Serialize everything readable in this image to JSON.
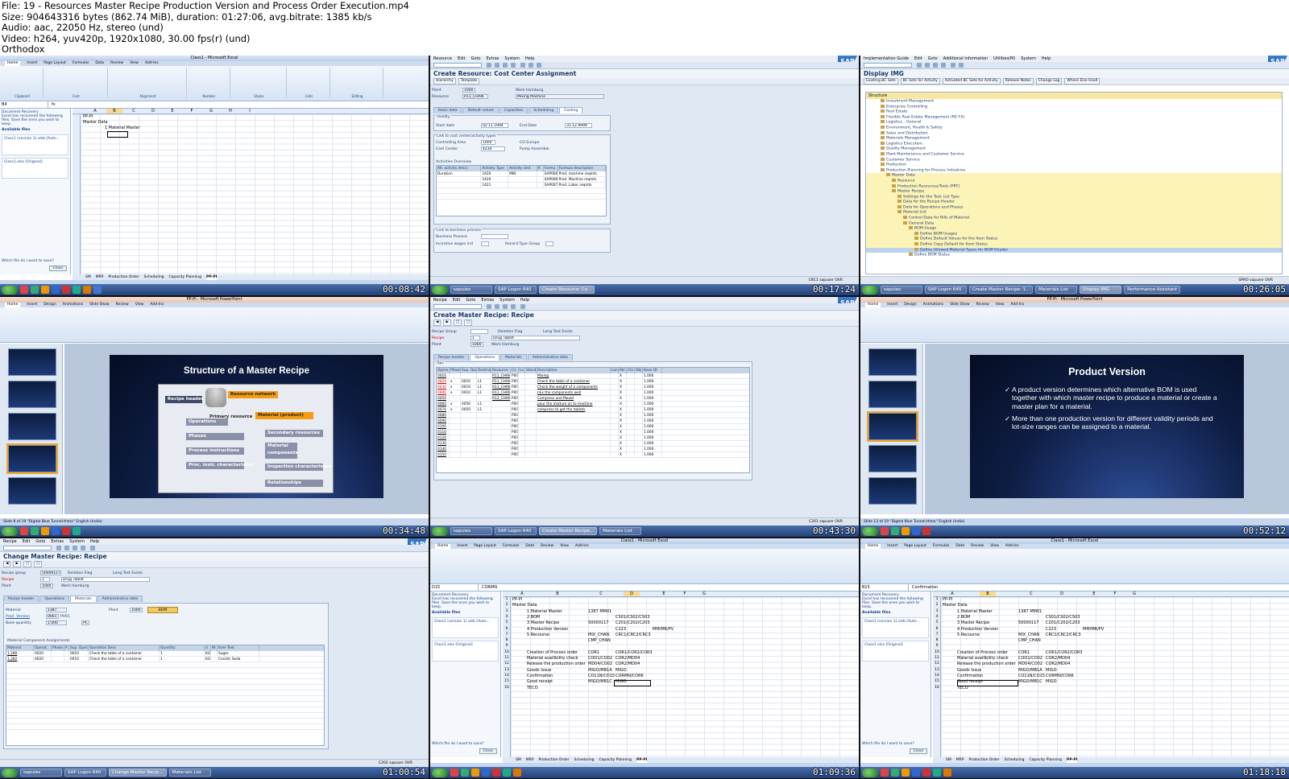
{
  "header": {
    "lines": [
      "File: 19 - Resources Master Recipe Production Version and Process Order Execution.mp4",
      "Size: 904643316 bytes (862.74 MiB), duration: 01:27:06, avg.bitrate: 1385 kb/s",
      "Audio: aac, 22050 Hz, stereo (und)",
      "Video: h264, yuv420p, 1920x1080, 30.00 fps(r) (und)",
      "Orthodox"
    ]
  },
  "tiles": {
    "t1": {
      "timestamp": "00:08:42",
      "title": "Class1 - Microsoft Excel",
      "name_box": "B4",
      "recovery_title": "Document Recovery",
      "recovery_text": "Excel has recovered the following files. Save the ones you wish to keep.",
      "available": "Available files",
      "file1": "Class1 (version 1).xlsb [Auto...",
      "file2": "Class1.xlsx [Original]",
      "close": "Close",
      "which": "Which file do I want to save?",
      "cells": {
        "a1": "PP-PI",
        "a2": "Master Data",
        "b4": "1 Material Master"
      },
      "sheets": [
        "SM",
        "MRP",
        "Production Order",
        "Scheduling",
        "Capacity Planning",
        "PP-PI"
      ]
    },
    "t2": {
      "timestamp": "00:17:24",
      "menu": [
        "Resource",
        "Edit",
        "Goto",
        "Extras",
        "System",
        "Help"
      ],
      "title": "Create Resource: Cost Center Assignment",
      "btn1": "Hierarchy",
      "btn2": "Template",
      "plant_lbl": "Plant",
      "plant": "1000",
      "plant_desc": "Werk Hamburg",
      "res_lbl": "Resource",
      "res": "R11_CHAN",
      "res_desc": "Mixing Machine",
      "tabs": [
        "Basic data",
        "Default values",
        "Capacities",
        "Scheduling",
        "Costing"
      ],
      "validity": "Validity",
      "start_lbl": "Start date",
      "start": "02.11.1994",
      "end_lbl": "End Date",
      "end": "31.12.9999",
      "link_cc": "Link to cost center/activity types",
      "ca_lbl": "Controlling Area",
      "ca": "1000",
      "ca_desc": "CO Europe",
      "cc_lbl": "Cost Center",
      "cc": "4230",
      "cc_desc": "Pump Assemble",
      "act_overview": "Activities Overview",
      "cols": [
        "Alt. activity descr.",
        "Activity Type",
        "Activity Unit",
        "R",
        "Formu",
        "Formula description"
      ],
      "rows": [
        [
          "Duration",
          "1420",
          "MIN",
          "",
          "SAP006",
          "Prod. machine reqmts"
        ],
        [
          "",
          "1420",
          "",
          "",
          "SAP006",
          "Prod. Machine reqmts"
        ],
        [
          "",
          "1421",
          "",
          "",
          "SAP007",
          "Prod. Labor reqmts"
        ]
      ],
      "link_bp": "Link to business process",
      "bp_lbl": "Business Process",
      "inc_lbl": "Incentive wages ind",
      "rec_lbl": "Record Type Group",
      "status": "CRC1 sapuser OVR"
    },
    "t3": {
      "timestamp": "00:26:05",
      "menu": [
        "Implementation Guide",
        "Edit",
        "Goto",
        "Additional information",
        "Utilities(M)",
        "System",
        "Help"
      ],
      "title": "Display IMG",
      "btns": [
        "Existing BC Sets",
        "BC Sets for Activity",
        "Activated BC Sets for Activity",
        "Release Notes",
        "Change Log",
        "Where Else Used"
      ],
      "structure": "Structure",
      "items": [
        "Investment Management",
        "Enterprise Controlling",
        "Real Estate",
        "Flexible Real Estate Management (RE-FX)",
        "Logistics - General",
        "Environment, Health & Safety",
        "Sales and Distribution",
        "Materials Management",
        "Logistics Execution",
        "Quality Management",
        "Plant Maintenance and Customer Service",
        "Customer Service",
        "Production",
        "Production Planning for Process Industries",
        "Master Data",
        "Resource",
        "Production Resources/Tools (PRT)",
        "Master Recipe",
        "Settings for the Task List Type",
        "Data for the Recipe Header",
        "Data for Operations and Phases",
        "Material List",
        "Control Data for Bills of Material",
        "General Data",
        "BOM Usage",
        "Define BOM Usages",
        "Define Default Values for the Item Status",
        "Define Copy Default for Item Status",
        "Define Allowed Material Types for BOM Header",
        "Define BOM Status"
      ],
      "status": "SPRO sapuser OVR"
    },
    "t4": {
      "timestamp": "00:34:48",
      "title": "PP-PI - Microsoft PowerPoint",
      "slide_title": "Structure of a Master Recipe",
      "boxes": [
        "Recipe header",
        "Resource network",
        "Material (product)",
        "Operations",
        "Primary resource",
        "Phases",
        "Secondary resources",
        "Process instructions",
        "Material components",
        "Proc. instr. characteristics",
        "Inspection characteristics",
        "Relationships"
      ],
      "status": "Slide 8 of 19    \"Digital Blue Tunnel.thmx\"    English (India)"
    },
    "t5": {
      "timestamp": "00:43:30",
      "menu": [
        "Recipe",
        "Edit",
        "Goto",
        "Extras",
        "System",
        "Help"
      ],
      "title": "Create Master Recipe: Recipe",
      "rg_lbl": "Recipe Group",
      "del_flag": "Deletion Flag",
      "long_text": "Long Text Exists",
      "recipe_lbl": "Recipe",
      "recipe": "1",
      "recipe_desc": "Drug Tablet",
      "plant_lbl": "Plant",
      "plant": "1000",
      "plant_desc": "Werk Hamburg",
      "tabs": [
        "Recipe header",
        "Operations",
        "Materials",
        "Administrative data"
      ],
      "ops": "Ops",
      "cols": [
        "Opera",
        "Phase in",
        "Sup. Operation",
        "Destinatn",
        "Resource",
        "Co",
        "Lo",
        "Standar",
        "Description",
        "Lon",
        "Rel",
        "Cla",
        "Obj",
        "Base Qt"
      ],
      "rows": [
        [
          "0010",
          "",
          "",
          "",
          "R11_CHAN",
          "PI01",
          "",
          "",
          "Mixing",
          "",
          "X",
          "",
          "",
          "1.000"
        ],
        [
          "0020",
          "x",
          "0010",
          "L1",
          "R11_CHAN",
          "PI01",
          "",
          "",
          "Check the table of a container",
          "",
          "X",
          "",
          "",
          "1.000"
        ],
        [
          "0030",
          "x",
          "0010",
          "L1",
          "R11_CHAN",
          "PI01",
          "",
          "",
          "Check the weight of a components",
          "",
          "X",
          "",
          "",
          "1.000"
        ],
        [
          "0040",
          "x",
          "0010",
          "L1",
          "R11_CHAN",
          "PI01",
          "",
          "",
          "mix the components well",
          "",
          "X",
          "",
          "",
          "1.000"
        ],
        [
          "0050",
          "",
          "",
          "",
          "R12_CHAN",
          "PI01",
          "",
          "",
          "Compress and Mould",
          "",
          "X",
          "",
          "",
          "1.000"
        ],
        [
          "0060",
          "x",
          "0050",
          "L1",
          "",
          "PI01",
          "",
          "",
          "pour the mixture on to machine",
          "",
          "X",
          "",
          "",
          "1.000"
        ],
        [
          "0070",
          "x",
          "0050",
          "L1",
          "",
          "PI01",
          "",
          "",
          "compress to get the tablets",
          "",
          "X",
          "",
          "",
          "1.000"
        ],
        [
          "0080",
          "",
          "",
          "",
          "",
          "PI01",
          "",
          "",
          "",
          "",
          "X",
          "",
          "",
          "1.000"
        ],
        [
          "0090",
          "",
          "",
          "",
          "",
          "PI01",
          "",
          "",
          "",
          "",
          "X",
          "",
          "",
          "1.000"
        ],
        [
          "0100",
          "",
          "",
          "",
          "",
          "PI01",
          "",
          "",
          "",
          "",
          "X",
          "",
          "",
          "1.000"
        ],
        [
          "0110",
          "",
          "",
          "",
          "",
          "PI01",
          "",
          "",
          "",
          "",
          "X",
          "",
          "",
          "1.000"
        ],
        [
          "0120",
          "",
          "",
          "",
          "",
          "PI01",
          "",
          "",
          "",
          "",
          "X",
          "",
          "",
          "1.000"
        ],
        [
          "0130",
          "",
          "",
          "",
          "",
          "PI01",
          "",
          "",
          "",
          "",
          "X",
          "",
          "",
          "1.000"
        ],
        [
          "0140",
          "",
          "",
          "",
          "",
          "PI01",
          "",
          "",
          "",
          "",
          "X",
          "",
          "",
          "1.000"
        ],
        [
          "0150",
          "",
          "",
          "",
          "",
          "PI01",
          "",
          "",
          "",
          "",
          "X",
          "",
          "",
          "1.000"
        ]
      ],
      "status": "C201 sapuser OVR"
    },
    "t6": {
      "timestamp": "00:52:12",
      "title": "PP-PI - Microsoft PowerPoint",
      "slide_title": "Product Version",
      "bullet1": "A product version determines which alternative BOM is used together with which master recipe to produce a material or create a master plan for a material.",
      "bullet2": "More than one production version for different validity periods and lot-size ranges can be assigned to a material.",
      "status": "Slide 13 of 19    \"Digital Blue Tunnel.thmx\"    English (India)"
    },
    "t7": {
      "timestamp": "01:00:54",
      "menu": [
        "Recipe",
        "Edit",
        "Goto",
        "Extras",
        "System",
        "Help"
      ],
      "title": "Change Master Recipe: Recipe",
      "rg_lbl": "Recipe group",
      "rg": "50000117",
      "del_flag": "Deletion Flag",
      "long_text": "Long Text Exists",
      "recipe_lbl": "Recipe",
      "recipe": "1",
      "recipe_desc": "Drug Tablet",
      "plant_lbl": "Plant",
      "plant": "1000",
      "plant_desc": "Werk Hamburg",
      "tabs": [
        "Recipe header",
        "Operations",
        "Materials",
        "Administrative data"
      ],
      "mat_lbl": "Material",
      "mat": "1387",
      "plant2_lbl": "Plant",
      "plant2": "1000",
      "bom": "BOM",
      "pv_lbl": "Prod. Version",
      "pv": "0001",
      "pv_desc": "PV01",
      "bq_lbl": "Base quantity",
      "bq": "1.000",
      "bq_unit": "PC",
      "assign": "Material Component Assignments",
      "cols": [
        "Material",
        "Operat..",
        "Phase",
        "P",
        "Sup. Operation",
        "Operation Desc",
        "Quantity",
        "U",
        "IN",
        "Item Text"
      ],
      "rows": [
        [
          "1,280",
          "0020",
          "",
          "",
          "0010",
          "Check the table of a container",
          "1",
          "KG",
          "",
          "Sugar"
        ],
        [
          "1,282",
          "0020",
          "",
          "",
          "0010",
          "Check the table of a container",
          "1",
          "KG",
          "",
          "Cosidic Soda"
        ]
      ],
      "status": "C202 sapuser OVR"
    },
    "t8": {
      "timestamp": "01:09:36",
      "title": "Class1 - Microsoft Excel",
      "name_box": "D15",
      "formula": "CORMN",
      "recovery_title": "Document Recovery",
      "recovery_text": "Excel has recovered the following files. Save the ones you wish to keep.",
      "available": "Available files",
      "file1": "Class1 (version 1).xlsb [Auto...",
      "file2": "Class1.xlsx [Original]",
      "close": "Close",
      "which": "Which file do I want to save?",
      "sheets": [
        "SM",
        "MRP",
        "Production Order",
        "Scheduling",
        "Capacity Planning",
        "PP-PI"
      ]
    },
    "t9": {
      "timestamp": "01:18:18",
      "title": "Class1 - Microsoft Excel",
      "name_box": "B15",
      "formula": "Confirmation",
      "recovery_title": "Document Recovery",
      "recovery_text": "Excel has recovered the following files. Save the ones you wish to keep.",
      "available": "Available files",
      "file1": "Class1 (version 1).xlsb [Auto...",
      "file2": "Class1.xlsx [Original]",
      "close": "Close",
      "which": "Which file do I want to save?",
      "sheets": [
        "SM",
        "MRP",
        "Production Order",
        "Scheduling",
        "Capacity Planning",
        "PP-PI"
      ]
    }
  },
  "excel_rows": [
    {
      "n": "1",
      "a": "PP-PI"
    },
    {
      "n": "2",
      "a": "Master Data"
    },
    {
      "n": "3",
      "b": "1 Material Master",
      "c": "1387 MM01"
    },
    {
      "n": "4",
      "b": "2 BOM",
      "c": "",
      "d": "CS01/CS02/CS03"
    },
    {
      "n": "5",
      "b": "3 Master Recipe",
      "c": "50000117",
      "d": "C201/C202/C203"
    },
    {
      "n": "6",
      "b": "4 Production Version",
      "c": "",
      "d": "C223",
      "e": "MM/MR/PV"
    },
    {
      "n": "7",
      "b": "5 Recourse",
      "c": "MIX_CHAN",
      "d": "CRC1/CRC2/CRC3"
    },
    {
      "n": "8",
      "c": "CMP_CHAN"
    },
    {
      "n": "9"
    },
    {
      "n": "10",
      "b": "Creation of Process order",
      "c": "COR1",
      "d": "COR1/COR2/COR3"
    },
    {
      "n": "11",
      "b": "Material availibility check",
      "c": "COO1/CO02",
      "d": "COR2/MD04"
    },
    {
      "n": "12",
      "b": "Release the production order",
      "c": "MD04/CO02",
      "d": "COR2/MD04"
    },
    {
      "n": "13",
      "b": "Goods Issue",
      "c": "MIGO/MB1A",
      "d": "MIGO"
    },
    {
      "n": "14",
      "b": "Confirmation",
      "c": "CO11N/CO15",
      "d": "CORMN/CORK"
    },
    {
      "n": "15",
      "b": "Good receipt",
      "c": "MIGO/MB1C",
      "d": "MIGO"
    },
    {
      "n": "16",
      "b": "TECO"
    }
  ],
  "taskbar": {
    "start": "Start",
    "t2_btns": [
      "sapuiex",
      "SAP Logon 640",
      "Create Resource: Co..."
    ],
    "t3_btns": [
      "sapuiex",
      "SAP Logon 640",
      "Create Master Recipe: 1...",
      "Materials List",
      "Display IMG",
      "Performance Assistant"
    ],
    "t5_btns": [
      "sapuiex",
      "SAP Logon 640",
      "Create Master Recipe...",
      "Materials List"
    ],
    "t7_btns": [
      "sapuiex",
      "SAP Logon 640",
      "Change Master Recip...",
      "Materials List"
    ]
  }
}
